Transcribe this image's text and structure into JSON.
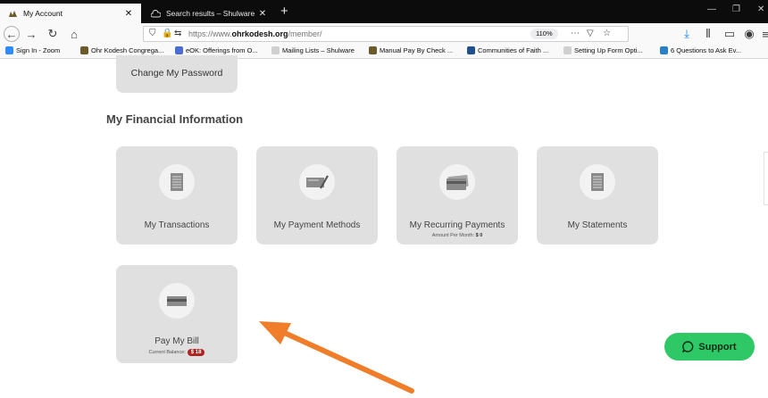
{
  "browser": {
    "tabs": [
      {
        "label": "My Account",
        "icon": "logo-icon",
        "active": true
      },
      {
        "label": "Search results – Shulware",
        "icon": "cloud-icon",
        "active": false
      }
    ],
    "url": {
      "prefix": "https://www.",
      "domain": "ohrkodesh.org",
      "path": "/member/"
    },
    "zoom": "110%",
    "bookmarks": [
      {
        "label": "Sign In - Zoom",
        "color": "#2d8cff"
      },
      {
        "label": "Ohr Kodesh Congrega...",
        "color": "#6b5a2a"
      },
      {
        "label": "eOK: Offerings from O...",
        "color": "#4a6cd4"
      },
      {
        "label": "Mailing Lists – Shulware",
        "color": "#777777"
      },
      {
        "label": "Manual Pay By Check ...",
        "color": "#6b5a2a"
      },
      {
        "label": "Communities of Faith ...",
        "color": "#1f4f8c"
      },
      {
        "label": "Setting Up Form Opti...",
        "color": "#777777"
      },
      {
        "label": "6 Questions to Ask Ev...",
        "color": "#2a7fc9"
      }
    ]
  },
  "page": {
    "change_password": "Change My Password",
    "section_title": "My Financial Information",
    "cards": {
      "transactions": {
        "title": "My Transactions"
      },
      "payment_methods": {
        "title": "My Payment Methods"
      },
      "recurring": {
        "title": "My Recurring Payments",
        "sub_label": "Amount Per Month:",
        "sub_value": "$ 0"
      },
      "statements": {
        "title": "My Statements"
      },
      "pay_bill": {
        "title": "Pay My Bill",
        "sub_label": "Current Balance:",
        "badge": "$ 18"
      }
    },
    "support_label": "Support"
  },
  "colors": {
    "card_bg": "#e0e0e0",
    "support_green": "#2ec866",
    "arrow_orange": "#f07d2a",
    "badge_red": "#b02323"
  }
}
